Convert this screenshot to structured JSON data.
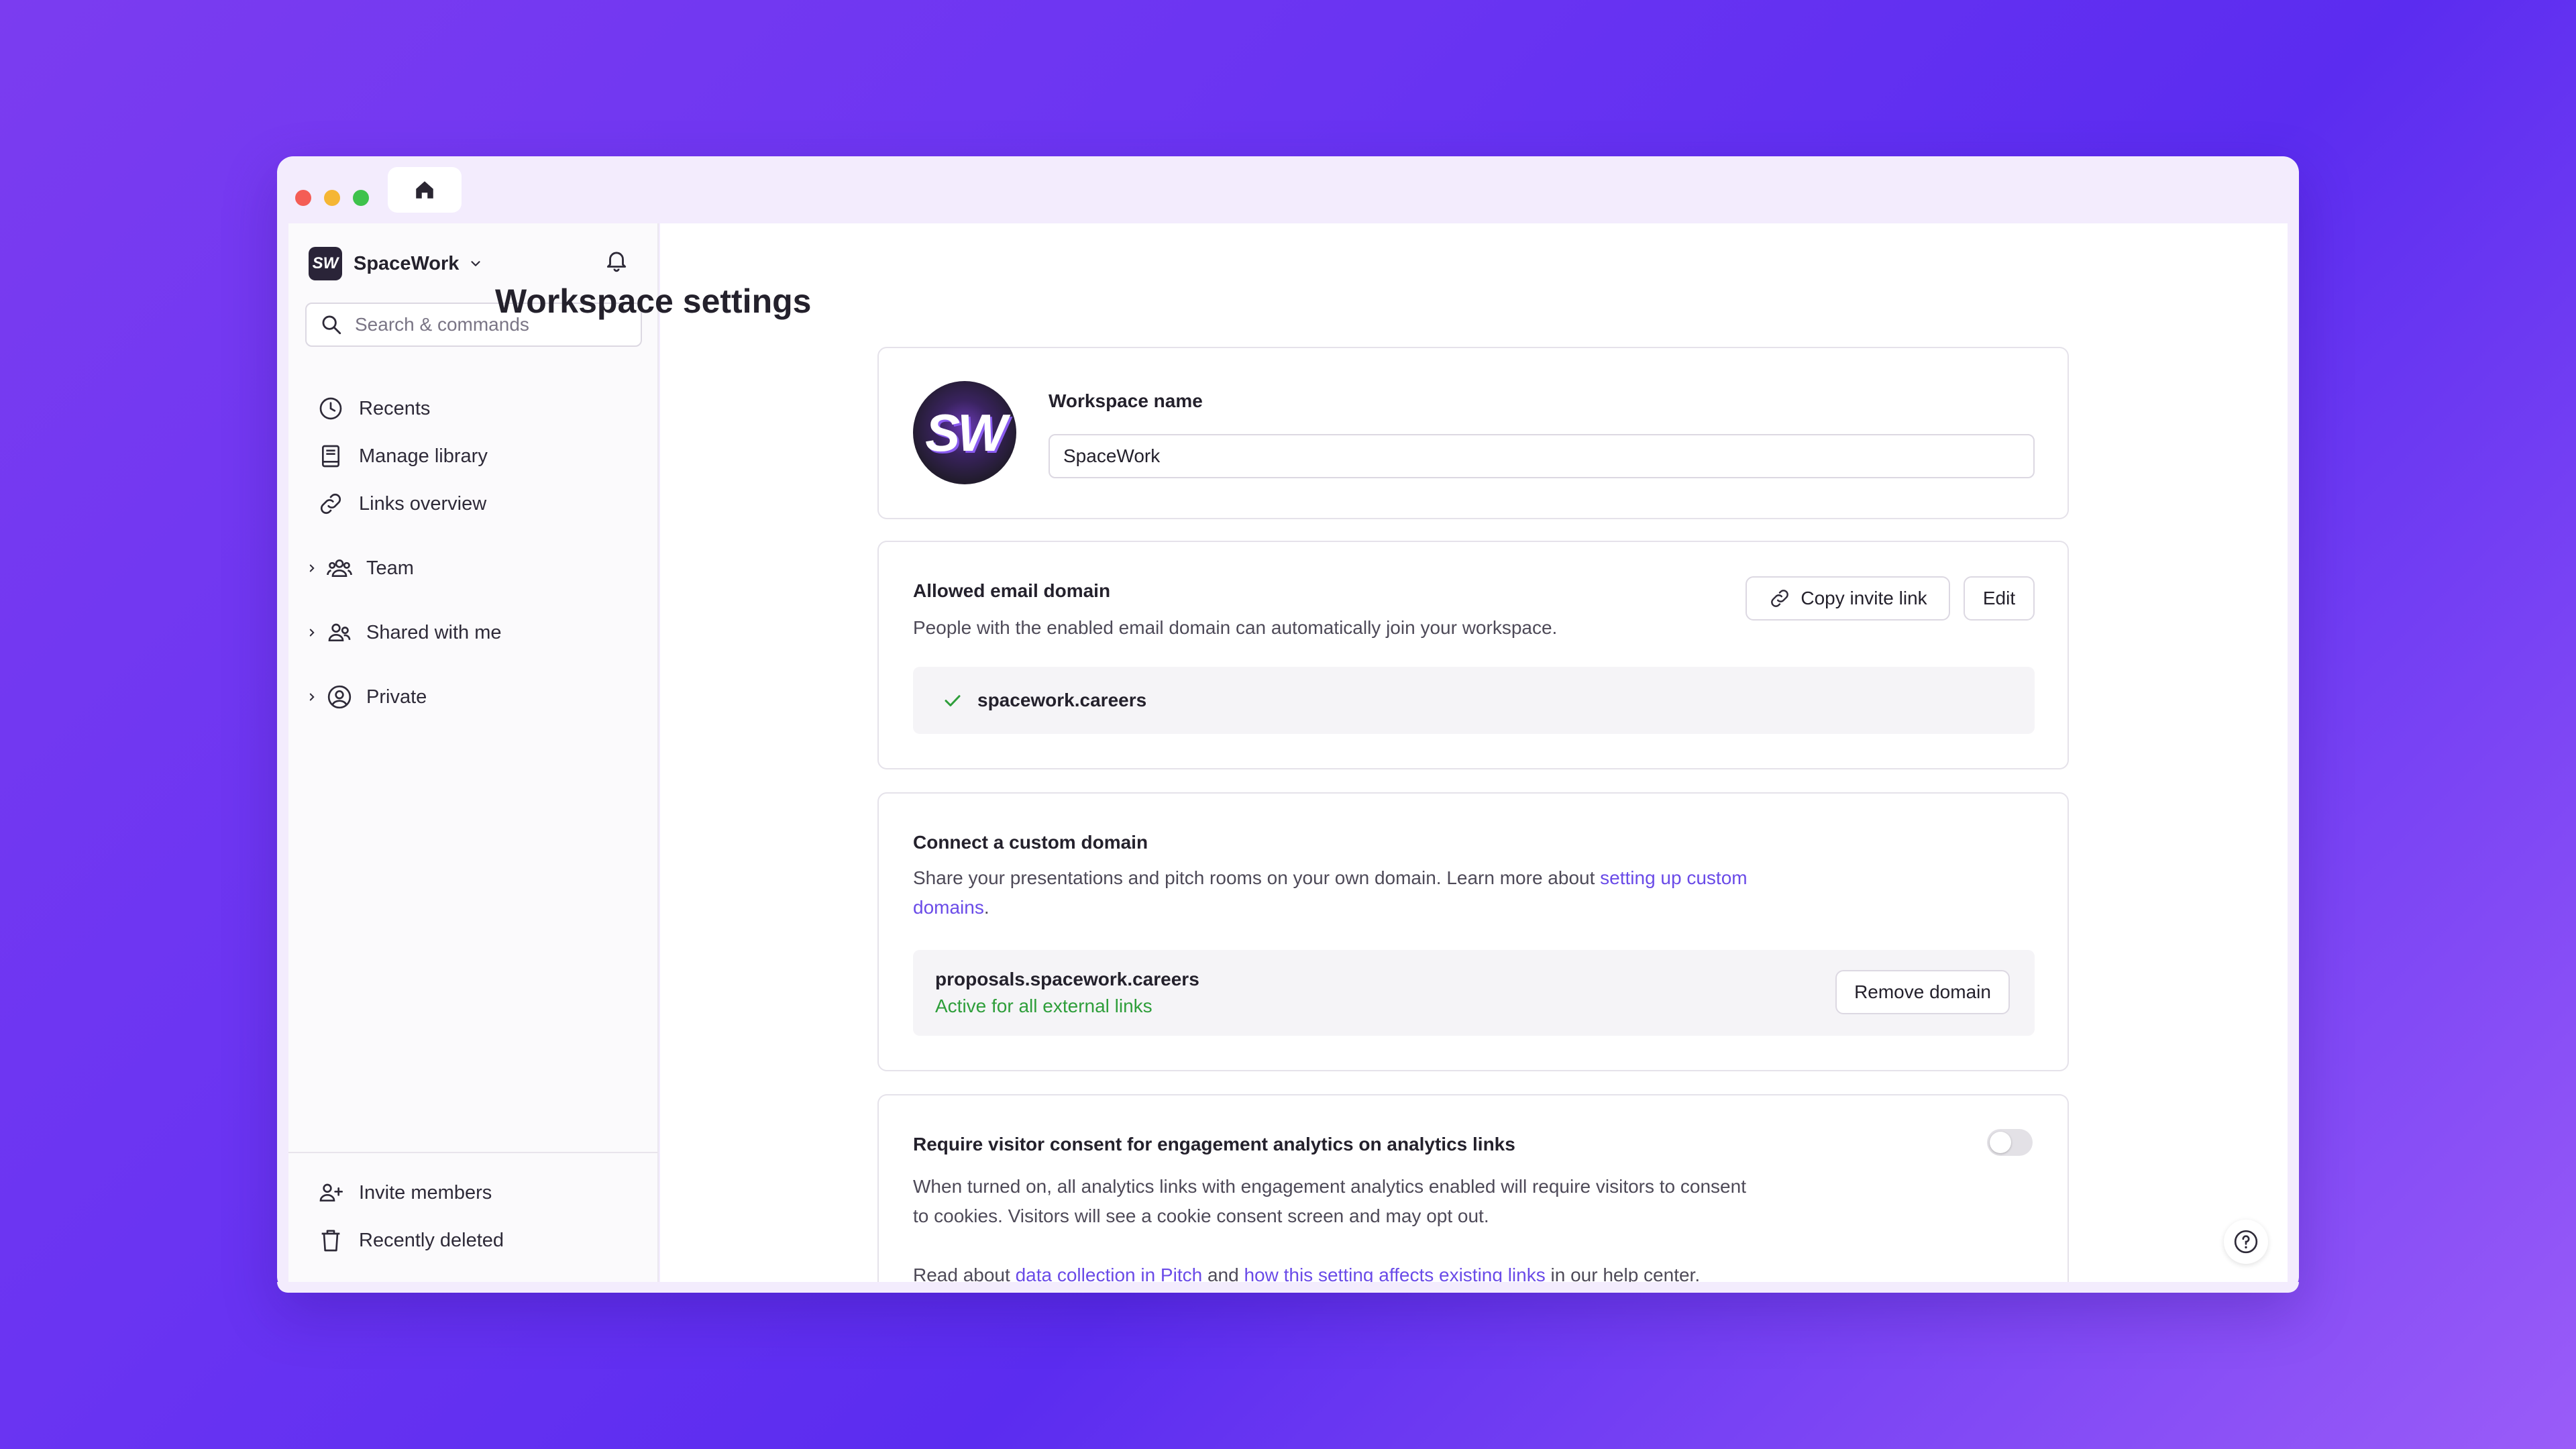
{
  "workspace": {
    "name": "SpaceWork",
    "logo_text": "SW"
  },
  "search": {
    "placeholder": "Search & commands"
  },
  "sidebar": {
    "items": [
      {
        "label": "Recents",
        "icon": "clock-icon"
      },
      {
        "label": "Manage library",
        "icon": "book-icon"
      },
      {
        "label": "Links overview",
        "icon": "link-icon"
      }
    ],
    "tree": [
      {
        "label": "Team",
        "icon": "team-icon"
      },
      {
        "label": "Shared with me",
        "icon": "users-icon"
      },
      {
        "label": "Private",
        "icon": "user-circle-icon"
      }
    ],
    "footer": [
      {
        "label": "Invite members",
        "icon": "user-plus-icon"
      },
      {
        "label": "Recently deleted",
        "icon": "trash-icon"
      }
    ]
  },
  "page": {
    "title": "Workspace settings"
  },
  "name_card": {
    "label": "Workspace name",
    "value": "SpaceWork"
  },
  "email_card": {
    "title": "Allowed email domain",
    "description": "People with the enabled email domain can automatically join your workspace.",
    "copy_button": "Copy invite link",
    "edit_button": "Edit",
    "domain": "spacework.careers"
  },
  "custom_domain_card": {
    "title": "Connect a custom domain",
    "description_prefix": "Share your presentations and pitch rooms on your own domain. Learn more about ",
    "link_part1": "setting up custom",
    "link_part2": "domains",
    "description_suffix": ".",
    "domain": "proposals.spacework.careers",
    "status": "Active for all external links",
    "remove_button": "Remove domain"
  },
  "consent_card": {
    "title": "Require visitor consent for engagement analytics on analytics links",
    "description_line1": "When turned on, all analytics links with engagement analytics enabled will require visitors to consent",
    "description_line2": "to cookies. Visitors will see a cookie consent screen and may opt out.",
    "read_prefix": "Read about ",
    "link1": "data collection in Pitch",
    "read_middle": " and ",
    "link2": "how this setting affects existing links",
    "read_suffix": " in our help center.",
    "toggle_on": false
  },
  "colors": {
    "accent": "#6a4be8",
    "success": "#2e9e3a",
    "background_gradient_start": "#7b3cf0",
    "background_gradient_end": "#9a5cf8"
  }
}
